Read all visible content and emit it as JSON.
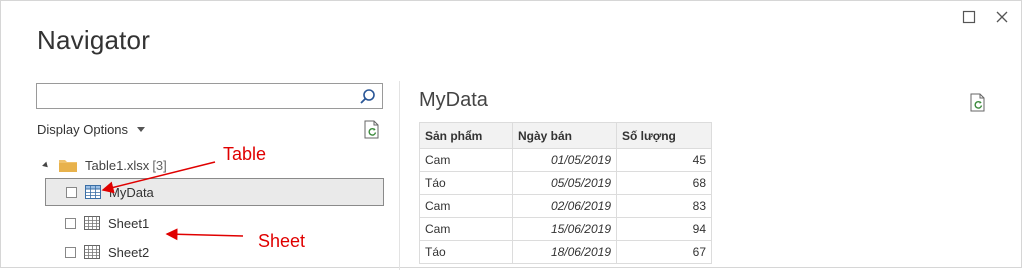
{
  "window": {
    "title": "Navigator"
  },
  "search": {
    "value": "",
    "placeholder": ""
  },
  "left_panel": {
    "display_options_label": "Display Options",
    "tree": {
      "root_label": "Table1.xlsx",
      "root_count": "[3]",
      "items": [
        {
          "label": "MyData",
          "type": "table",
          "checked": false,
          "selected": true
        },
        {
          "label": "Sheet1",
          "type": "sheet",
          "checked": false,
          "selected": false
        },
        {
          "label": "Sheet2",
          "type": "sheet",
          "checked": false,
          "selected": false
        }
      ]
    }
  },
  "preview": {
    "title": "MyData",
    "columns": [
      "Sản phẩm",
      "Ngày bán",
      "Số lượng"
    ],
    "rows": [
      [
        "Cam",
        "01/05/2019",
        "45"
      ],
      [
        "Táo",
        "05/05/2019",
        "68"
      ],
      [
        "Cam",
        "02/06/2019",
        "83"
      ],
      [
        "Cam",
        "15/06/2019",
        "94"
      ],
      [
        "Táo",
        "18/06/2019",
        "67"
      ]
    ]
  },
  "annotations": {
    "table_label": "Table",
    "sheet_label": "Sheet",
    "color": "#e00000"
  },
  "icons": [
    "maximize-icon",
    "close-icon",
    "search-icon",
    "refresh-icon",
    "folder-icon",
    "table-icon",
    "sheet-icon",
    "expand-icon",
    "dropdown-caret-icon"
  ]
}
